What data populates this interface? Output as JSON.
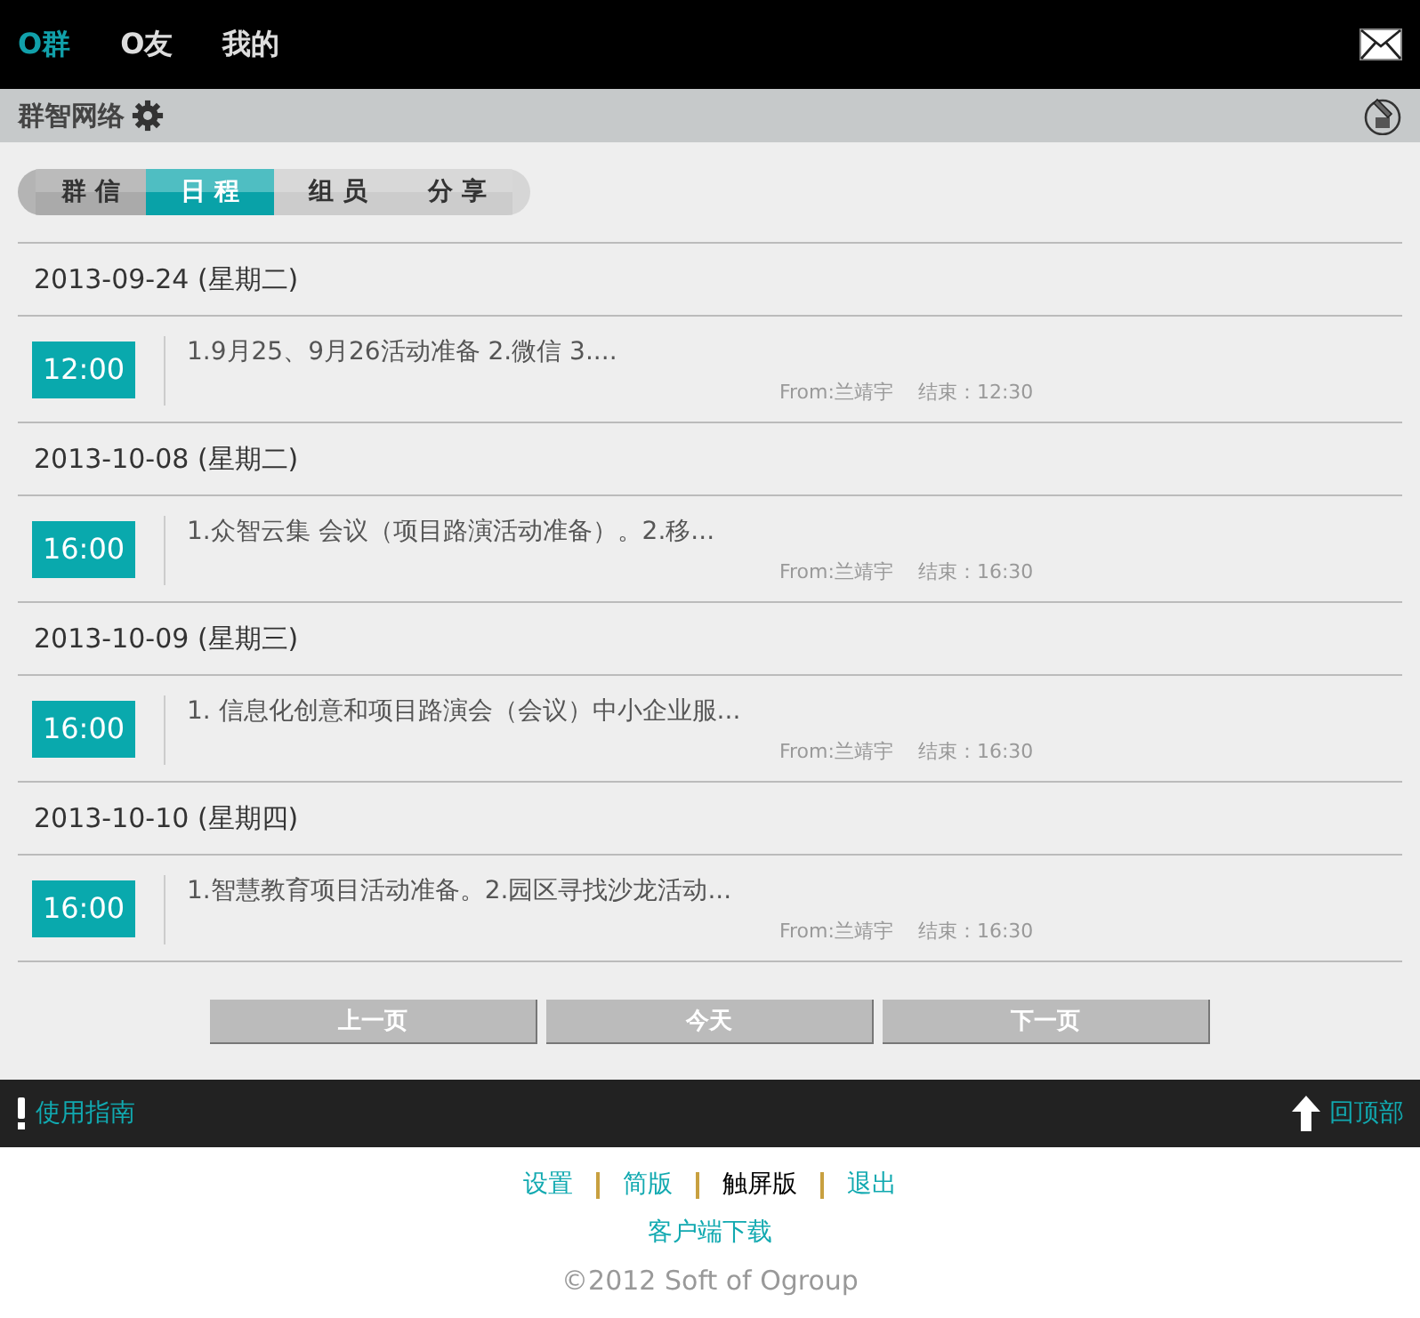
{
  "top_nav": [
    {
      "label": "O群",
      "selected": true
    },
    {
      "label": "O友",
      "selected": false
    },
    {
      "label": "我的",
      "selected": false
    }
  ],
  "group_bar": {
    "title": "群智网络"
  },
  "tabs": [
    {
      "label": "群 信",
      "selected": false
    },
    {
      "label": "日 程",
      "selected": true
    },
    {
      "label": "组 员",
      "selected": false
    },
    {
      "label": "分 享",
      "selected": false
    }
  ],
  "days": [
    {
      "date": "2013-09-24 (星期二)",
      "events": [
        {
          "time": "12:00",
          "title": "1.9月25、9月26活动准备 2.微信 3....",
          "from": "From:兰靖宇",
          "end": "结束：12:30"
        }
      ]
    },
    {
      "date": "2013-10-08 (星期二)",
      "events": [
        {
          "time": "16:00",
          "title": "1.众智云集 会议（项目路演活动准备）。2.移...",
          "from": "From:兰靖宇",
          "end": "结束：16:30"
        }
      ]
    },
    {
      "date": "2013-10-09 (星期三)",
      "events": [
        {
          "time": "16:00",
          "title": "1. 信息化创意和项目路演会（会议）中小企业服...",
          "from": "From:兰靖宇",
          "end": "结束：16:30"
        }
      ]
    },
    {
      "date": "2013-10-10 (星期四)",
      "events": [
        {
          "time": "16:00",
          "title": "1.智慧教育项目活动准备。2.园区寻找沙龙活动...",
          "from": "From:兰靖宇",
          "end": "结束：16:30"
        }
      ]
    }
  ],
  "pager": [
    "上一页",
    "今天",
    "下一页"
  ],
  "bottom_bar": {
    "guide": "使用指南",
    "top": "回顶部"
  },
  "footer_links": [
    {
      "label": "设置",
      "selected": false
    },
    {
      "label": "简版",
      "selected": false
    },
    {
      "label": "触屏版",
      "selected": true
    },
    {
      "label": "退出",
      "selected": false
    }
  ],
  "download": "客户端下载",
  "copyright": "©2012 Soft of Ogroup"
}
